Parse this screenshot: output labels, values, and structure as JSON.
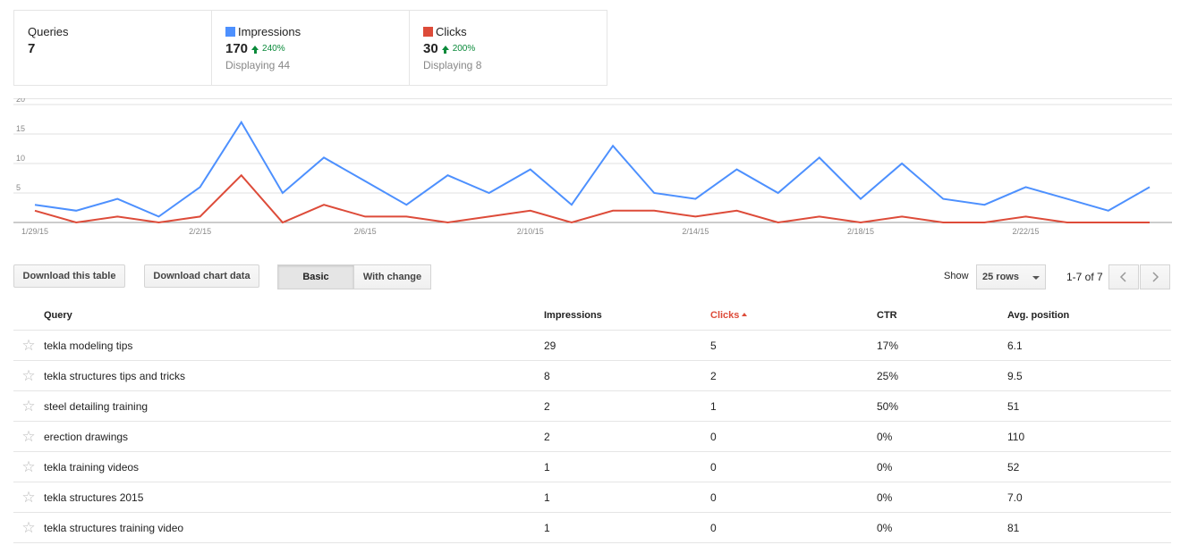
{
  "summary": {
    "queries": {
      "label": "Queries",
      "value": "7"
    },
    "impressions": {
      "label": "Impressions",
      "value": "170",
      "change": "240%",
      "sub": "Displaying 44",
      "color": "#4d90fe"
    },
    "clicks": {
      "label": "Clicks",
      "value": "30",
      "change": "200%",
      "sub": "Displaying 8",
      "color": "#dd4b39"
    }
  },
  "chart_data": {
    "type": "line",
    "x": [
      "1/29/15",
      "1/30/15",
      "1/31/15",
      "2/1/15",
      "2/2/15",
      "2/3/15",
      "2/4/15",
      "2/5/15",
      "2/6/15",
      "2/7/15",
      "2/8/15",
      "2/9/15",
      "2/10/15",
      "2/11/15",
      "2/12/15",
      "2/13/15",
      "2/14/15",
      "2/15/15",
      "2/16/15",
      "2/17/15",
      "2/18/15",
      "2/19/15",
      "2/20/15",
      "2/21/15",
      "2/22/15",
      "2/23/15",
      "2/24/15",
      "2/25/15"
    ],
    "tick_labels": [
      "1/29/15",
      "2/2/15",
      "2/6/15",
      "2/10/15",
      "2/14/15",
      "2/18/15",
      "2/22/15"
    ],
    "series": [
      {
        "values": [
          3,
          2,
          4,
          1,
          6,
          17,
          5,
          11,
          7,
          3,
          8,
          5,
          9,
          3,
          13,
          5,
          4,
          9,
          5,
          11,
          4,
          10,
          4,
          3,
          6,
          4,
          2,
          6
        ],
        "color": "#4d90fe"
      },
      {
        "values": [
          2,
          0,
          1,
          0,
          1,
          8,
          0,
          3,
          1,
          1,
          0,
          1,
          2,
          0,
          2,
          2,
          1,
          2,
          0,
          1,
          0,
          1,
          0,
          0,
          1,
          0,
          0,
          0
        ],
        "color": "#dd4b39"
      }
    ],
    "ylim": [
      0,
      20
    ],
    "yticks": [
      5,
      10,
      15,
      20
    ],
    "grid": true
  },
  "toolbar": {
    "download_table": "Download this table",
    "download_chart": "Download chart data",
    "basic": "Basic",
    "with_change": "With change",
    "show_label": "Show",
    "rows_value": "25 rows",
    "pager": "1-7 of 7"
  },
  "table": {
    "headers": {
      "query": "Query",
      "impressions": "Impressions",
      "clicks": "Clicks",
      "ctr": "CTR",
      "position": "Avg. position"
    },
    "rows": [
      {
        "query": "tekla modeling tips",
        "impressions": "29",
        "clicks": "5",
        "ctr": "17%",
        "position": "6.1"
      },
      {
        "query": "tekla structures tips and tricks",
        "impressions": "8",
        "clicks": "2",
        "ctr": "25%",
        "position": "9.5"
      },
      {
        "query": "steel detailing training",
        "impressions": "2",
        "clicks": "1",
        "ctr": "50%",
        "position": "51"
      },
      {
        "query": "erection drawings",
        "impressions": "2",
        "clicks": "0",
        "ctr": "0%",
        "position": "110"
      },
      {
        "query": "tekla training videos",
        "impressions": "1",
        "clicks": "0",
        "ctr": "0%",
        "position": "52"
      },
      {
        "query": "tekla structures 2015",
        "impressions": "1",
        "clicks": "0",
        "ctr": "0%",
        "position": "7.0"
      },
      {
        "query": "tekla structures training video",
        "impressions": "1",
        "clicks": "0",
        "ctr": "0%",
        "position": "81"
      }
    ]
  }
}
